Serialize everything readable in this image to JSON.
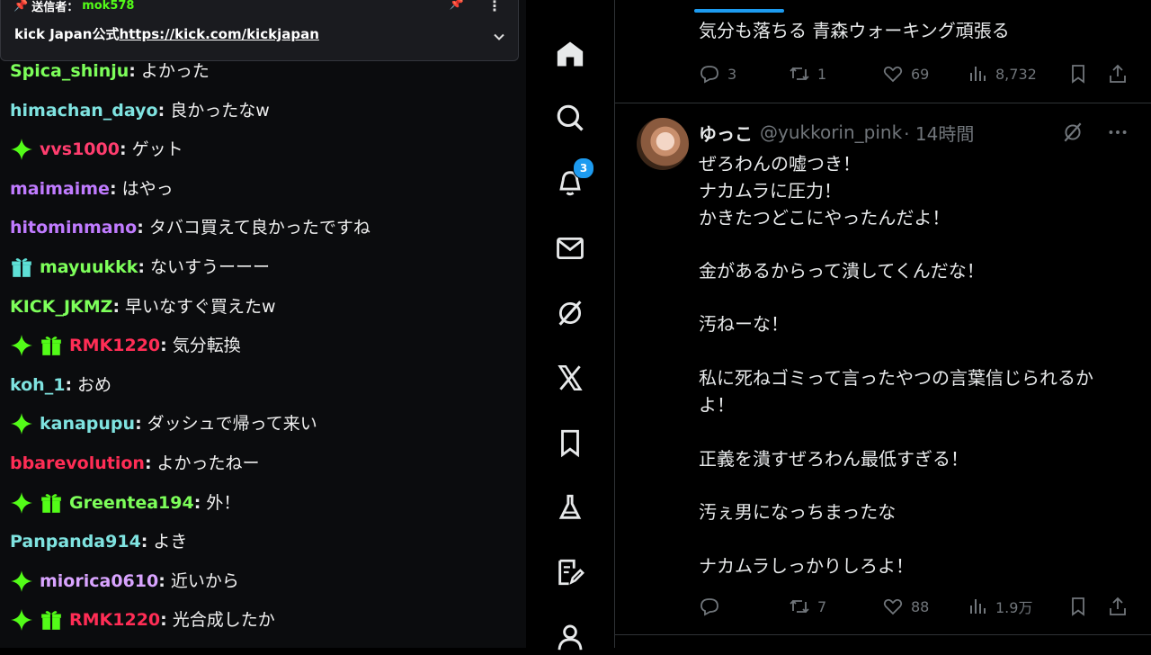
{
  "chat": {
    "pinned": {
      "sender_label": "送信者：",
      "sender_name": "mok578",
      "text_prefix": "kick Japan公式",
      "link": "https://kick.com/kickjapan"
    },
    "messages": [
      {
        "user": "Spica_shinju",
        "color": "#7dff5a",
        "badges": [],
        "text": "よかった"
      },
      {
        "user": "himachan_dayo",
        "color": "#7fe3e0",
        "badges": [],
        "text": "良かったなw"
      },
      {
        "user": "vvs1000",
        "color": "#ff3d6e",
        "badges": [
          "sparkle"
        ],
        "text": "ゲット"
      },
      {
        "user": "maimaime",
        "color": "#c07bff",
        "badges": [],
        "text": "はやっ"
      },
      {
        "user": "hitominmano",
        "color": "#c07bff",
        "badges": [],
        "text": "タバコ買えて良かったですね"
      },
      {
        "user": "mayuukkk",
        "color": "#7dff5a",
        "badges": [
          "gift-teal"
        ],
        "text": "ないすうーーー"
      },
      {
        "user": "KICK_JKMZ",
        "color": "#7dff5a",
        "badges": [],
        "text": "早いなすぐ買えたw"
      },
      {
        "user": "RMK1220",
        "color": "#ff2d55",
        "badges": [
          "sparkle",
          "gift-green"
        ],
        "text": "気分転換"
      },
      {
        "user": "koh_1",
        "color": "#7fe3e0",
        "badges": [],
        "text": "おめ"
      },
      {
        "user": "kanapupu",
        "color": "#7fe3e0",
        "badges": [
          "sparkle"
        ],
        "text": "ダッシュで帰って来い"
      },
      {
        "user": "bbarevolution",
        "color": "#ff2d55",
        "badges": [],
        "text": "よかったねー"
      },
      {
        "user": "Greentea194",
        "color": "#7dff5a",
        "badges": [
          "sparkle",
          "gift-green"
        ],
        "text": "外！"
      },
      {
        "user": "Panpanda914",
        "color": "#7fe3e0",
        "badges": [],
        "text": "よき"
      },
      {
        "user": "miorica0610",
        "color": "#d9a4ff",
        "badges": [
          "sparkle"
        ],
        "text": "近いから"
      },
      {
        "user": "RMK1220",
        "color": "#ff2d55",
        "badges": [
          "sparkle",
          "gift-green"
        ],
        "text": "光合成したか"
      }
    ]
  },
  "nav": {
    "items": [
      "home-icon",
      "search-icon",
      "notifications-icon",
      "messages-icon",
      "grok-icon",
      "x-premium-icon",
      "bookmarks-icon",
      "labs-icon",
      "compose-icon",
      "profile-icon"
    ],
    "notification_count": "3"
  },
  "feed": {
    "post1": {
      "text": "気分も落ちる 青森ウォーキング頑張る",
      "replies": "3",
      "reposts": "1",
      "likes": "69",
      "views": "8,732"
    },
    "post2": {
      "name": "ゆっこ",
      "handle": "@yukkorin_pink",
      "time": "· 14時間",
      "lines": [
        "ぜろわんの嘘つき！",
        "ナカムラに圧力！",
        "かきたつどこにやったんだよ！",
        "金があるからって潰してくんだな！",
        "汚ねーな！",
        "私に死ねゴミって言ったやつの言葉信じられるか",
        "よ！",
        "正義を潰すぜろわん最低すぎる！",
        "汚ぇ男になっちまったな",
        "ナカムラしっかりしろよ！"
      ],
      "replies": "",
      "reposts": "7",
      "likes": "88",
      "views": "1.9万"
    },
    "colors": {
      "accent": "#1d9bf0",
      "muted": "#71767b"
    }
  }
}
